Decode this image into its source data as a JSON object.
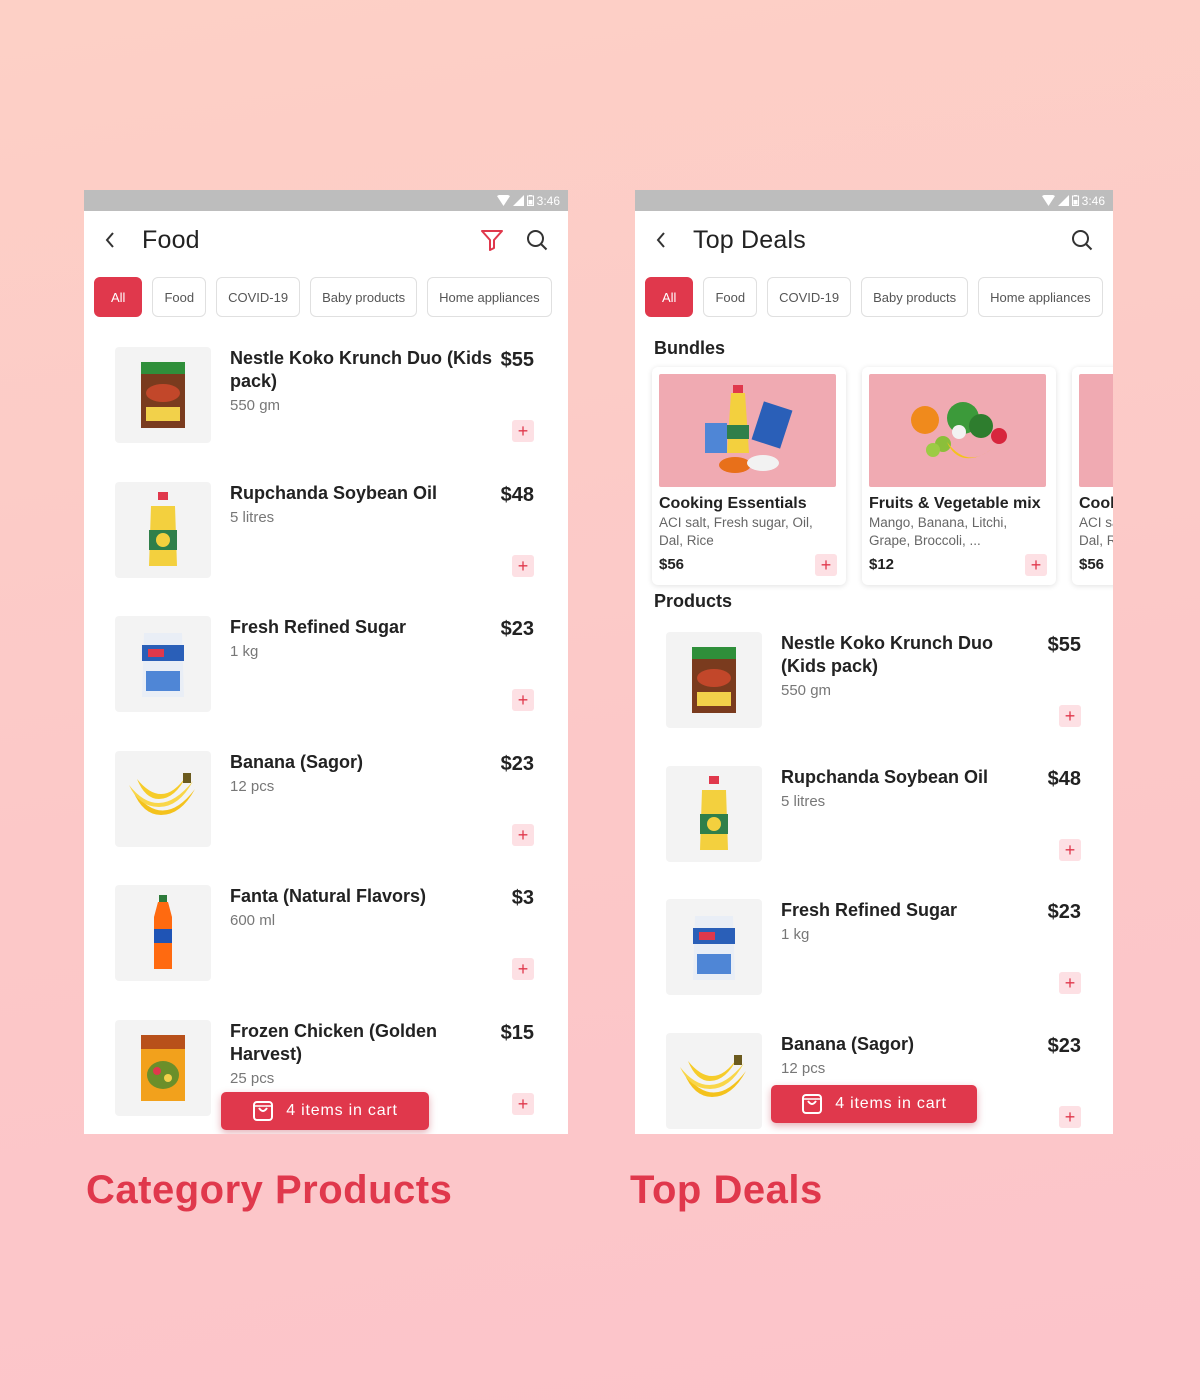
{
  "colors": {
    "accent": "#e0384c",
    "add_button_bg": "#fde0e4",
    "bundle_image_bg": "#f0aab2"
  },
  "status_time": "3:46",
  "category_screen": {
    "title": "Food",
    "icons": [
      "back-icon",
      "filter-icon",
      "search-icon"
    ],
    "chips": [
      {
        "label": "All",
        "active": true
      },
      {
        "label": "Food",
        "active": false
      },
      {
        "label": "COVID-19",
        "active": false
      },
      {
        "label": "Baby products",
        "active": false
      },
      {
        "label": "Home appliances",
        "active": false
      }
    ],
    "products": [
      {
        "name": "Nestle Koko Krunch Duo (Kids pack)",
        "qty": "550 gm",
        "price": "$55",
        "icon": "cereal-box"
      },
      {
        "name": "Rupchanda Soybean Oil",
        "qty": "5 litres",
        "price": "$48",
        "icon": "oil-bottle"
      },
      {
        "name": "Fresh Refined Sugar",
        "qty": "1 kg",
        "price": "$23",
        "icon": "sugar-pack"
      },
      {
        "name": "Banana (Sagor)",
        "qty": "12 pcs",
        "price": "$23",
        "icon": "banana"
      },
      {
        "name": "Fanta (Natural Flavors)",
        "qty": "600 ml",
        "price": "$3",
        "icon": "soda-bottle"
      },
      {
        "name": "Frozen Chicken (Golden Harvest)",
        "qty": "25 pcs",
        "price": "$15",
        "icon": "frozen-box"
      }
    ],
    "cart_label": "4 items in cart",
    "caption": "Category Products"
  },
  "deals_screen": {
    "title": "Top Deals",
    "icons": [
      "back-icon",
      "search-icon"
    ],
    "chips": [
      {
        "label": "All",
        "active": true
      },
      {
        "label": "Food",
        "active": false
      },
      {
        "label": "COVID-19",
        "active": false
      },
      {
        "label": "Baby products",
        "active": false
      },
      {
        "label": "Home appliances",
        "active": false
      }
    ],
    "bundles_title": "Bundles",
    "bundles": [
      {
        "name": "Cooking Essentials",
        "desc": "ACI salt, Fresh sugar, Oil, Dal, Rice",
        "price": "$56"
      },
      {
        "name": "Fruits & Vegetable mix",
        "desc": "Mango, Banana, Litchi, Grape, Broccoli, ...",
        "price": "$12"
      },
      {
        "name": "Cooking Essentials",
        "desc": "ACI salt, Fresh sugar, Oil, Dal, Rice",
        "price": "$56"
      }
    ],
    "products_title": "Products",
    "products": [
      {
        "name": "Nestle Koko Krunch Duo (Kids pack)",
        "qty": "550 gm",
        "price": "$55",
        "icon": "cereal-box"
      },
      {
        "name": "Rupchanda Soybean Oil",
        "qty": "5 litres",
        "price": "$48",
        "icon": "oil-bottle"
      },
      {
        "name": "Fresh Refined Sugar",
        "qty": "1 kg",
        "price": "$23",
        "icon": "sugar-pack"
      },
      {
        "name": "Banana (Sagor)",
        "qty": "12 pcs",
        "price": "$23",
        "icon": "banana"
      }
    ],
    "cart_label": "4 items in cart",
    "caption": "Top Deals"
  }
}
